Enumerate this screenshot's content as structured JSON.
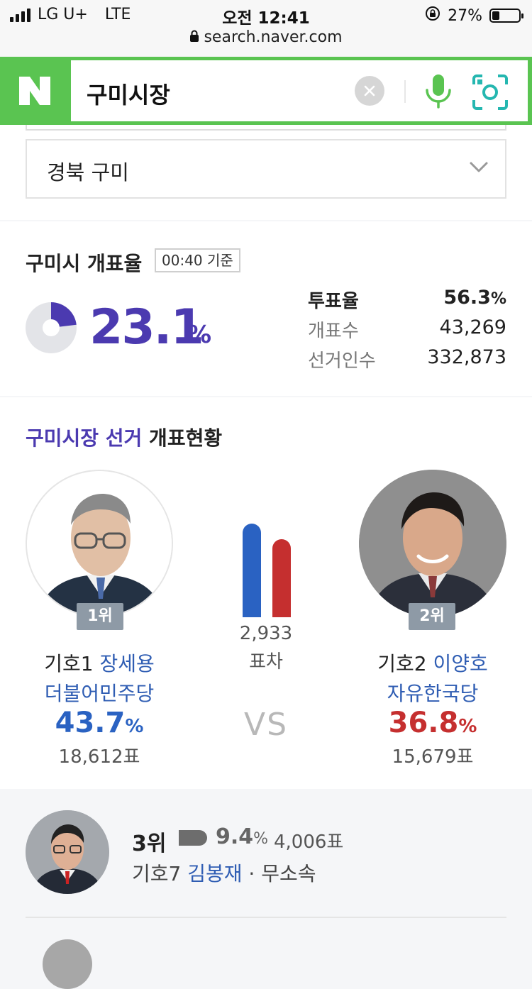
{
  "status_bar": {
    "carrier": "LG U+",
    "network": "LTE",
    "time": "오전 12:41",
    "url": "search.naver.com",
    "battery": "27%",
    "battery_level": 0.27
  },
  "search": {
    "logo": "N",
    "query": "구미시장"
  },
  "region_select": {
    "selected": "경북 구미"
  },
  "counting_rate": {
    "title": "구미시 개표율",
    "as_of": "00:40 기준",
    "percent": "23.1",
    "percent_unit": "%",
    "percent_value": 0.231,
    "turnout_label": "투표율",
    "turnout_value": "56.3",
    "turnout_unit": "%",
    "counted_label": "개표수",
    "counted_value": "43,269",
    "electorate_label": "선거인수",
    "electorate_value": "332,873"
  },
  "status": {
    "title_highlight": "구미시장 선거",
    "title_rest": " 개표현황",
    "gap_votes": "2,933",
    "gap_label": "표차",
    "vs": "VS",
    "candidates": [
      {
        "rank": "1위",
        "number": "기호1",
        "name": "장세용",
        "party": "더불어민주당",
        "percent": "43.7",
        "percent_unit": "%",
        "votes": "18,612표",
        "color": "#2a62c2"
      },
      {
        "rank": "2위",
        "number": "기호2",
        "name": "이양호",
        "party": "자유한국당",
        "percent": "36.8",
        "percent_unit": "%",
        "votes": "15,679표",
        "color": "#c52f2f"
      }
    ]
  },
  "third": {
    "rank": "3위",
    "percent": "9.4",
    "percent_unit": "%",
    "votes": "4,006표",
    "number": "기호7",
    "name": "김봉재",
    "separator": " · ",
    "party": "무소속"
  }
}
